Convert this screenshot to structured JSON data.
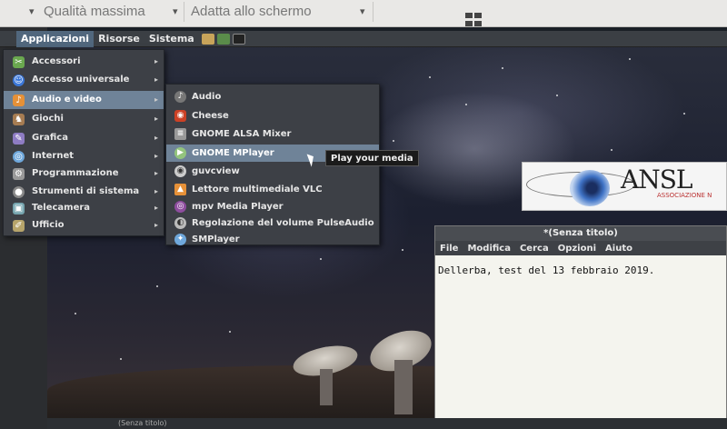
{
  "viewer_toolbar": {
    "quality_value": "Qualità massima",
    "fit_value": "Adatta allo schermo"
  },
  "panel": {
    "menus": [
      "Applicazioni",
      "Risorse",
      "Sistema"
    ]
  },
  "menu": {
    "items": [
      {
        "label": "Accessori",
        "icon": "accessories-icon",
        "color": "#6aa84f"
      },
      {
        "label": "Accesso universale",
        "icon": "accessibility-icon",
        "color": "#3c78d8"
      },
      {
        "label": "Audio e video",
        "icon": "multimedia-icon",
        "color": "#e69138"
      },
      {
        "label": "Giochi",
        "icon": "games-icon",
        "color": "#a67c52"
      },
      {
        "label": "Grafica",
        "icon": "graphics-icon",
        "color": "#8e7cc3"
      },
      {
        "label": "Internet",
        "icon": "internet-icon",
        "color": "#6fa8dc"
      },
      {
        "label": "Programmazione",
        "icon": "programming-icon",
        "color": "#999999"
      },
      {
        "label": "Strumenti di sistema",
        "icon": "system-tools-icon",
        "color": "#888888"
      },
      {
        "label": "Telecamera",
        "icon": "camera-icon",
        "color": "#76a5af"
      },
      {
        "label": "Ufficio",
        "icon": "office-icon",
        "color": "#b6a46b"
      }
    ],
    "highlighted_index": 2
  },
  "submenu": {
    "items": [
      {
        "label": "Audio",
        "icon": "audio-icon",
        "color": "#777777"
      },
      {
        "label": "Cheese",
        "icon": "cheese-icon",
        "color": "#cc4125"
      },
      {
        "label": "GNOME ALSA Mixer",
        "icon": "mixer-icon",
        "color": "#999999"
      },
      {
        "label": "GNOME MPlayer",
        "icon": "mplayer-icon",
        "color": "#93c47d"
      },
      {
        "label": "guvcview",
        "icon": "webcam-icon",
        "color": "#cccccc"
      },
      {
        "label": "Lettore multimediale VLC",
        "icon": "vlc-icon",
        "color": "#e69138"
      },
      {
        "label": "mpv Media Player",
        "icon": "mpv-icon",
        "color": "#8e4d9e"
      },
      {
        "label": "Regolazione del volume PulseAudio",
        "icon": "volume-icon",
        "color": "#bbbbbb"
      },
      {
        "label": "SMPlayer",
        "icon": "smplayer-icon",
        "color": "#6fa8dc"
      }
    ],
    "highlighted_index": 3
  },
  "tooltip": "Play your media",
  "logo": {
    "text": "ANSL",
    "subtitle": "ASSOCIAZIONE N"
  },
  "editor": {
    "title": "*(Senza titolo)",
    "menu": [
      "File",
      "Modifica",
      "Cerca",
      "Opzioni",
      "Aiuto"
    ],
    "content": "Dellerba, test del 13 febbraio 2019."
  },
  "taskbar": {
    "button_label": "(Senza titolo)"
  }
}
